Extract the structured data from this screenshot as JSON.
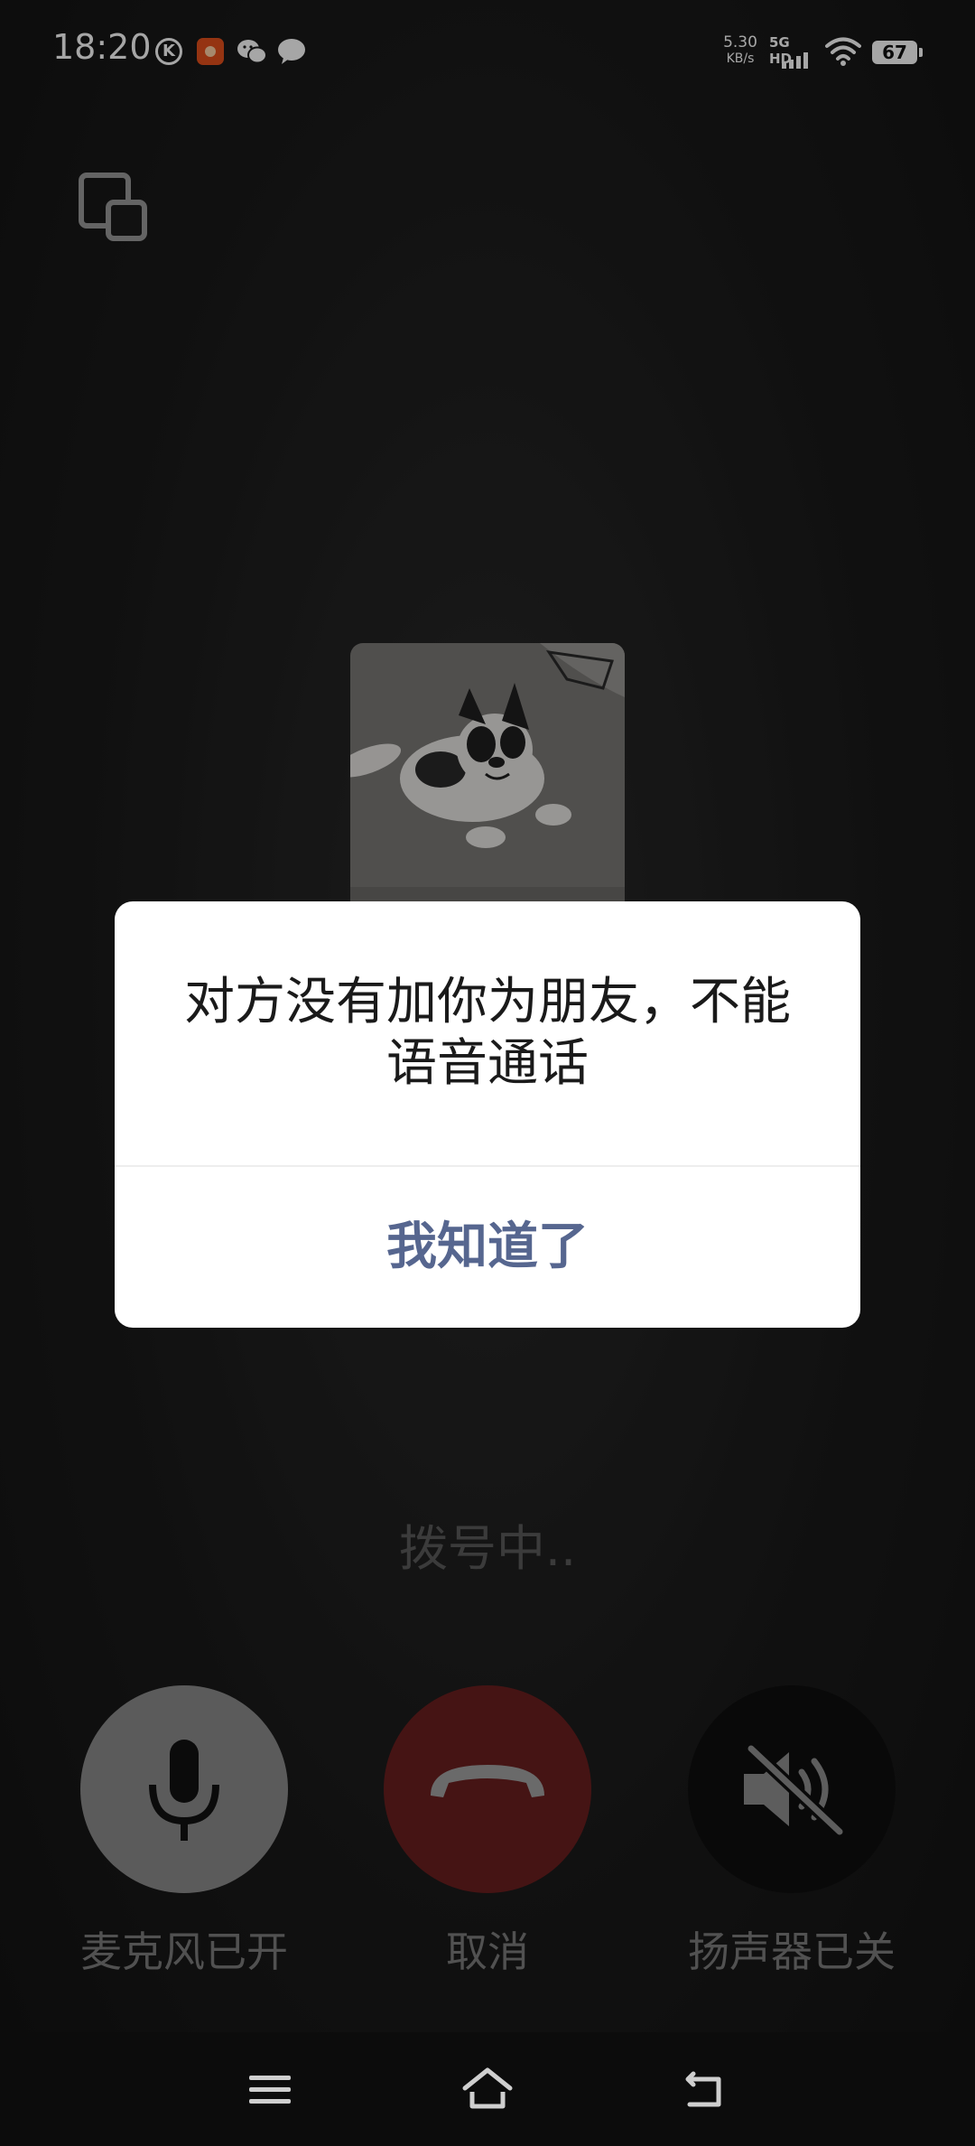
{
  "status_bar": {
    "time": "18:20",
    "net_speed_value": "5.30",
    "net_speed_unit": "KB/s",
    "network_label": "5G HD",
    "battery": "67",
    "notification_icons": [
      "k-app-icon",
      "orange-app-icon",
      "wechat-icon",
      "message-icon"
    ]
  },
  "call": {
    "status_text": "拨号中..",
    "controls": {
      "mic_label": "麦克风已开",
      "cancel_label": "取消",
      "speaker_label": "扬声器已关"
    }
  },
  "dialog": {
    "message": "对方没有加你为朋友，不能语音通话",
    "confirm_label": "我知道了"
  },
  "colors": {
    "background": "#1b1b1b",
    "mic_button": "#8c8c8c",
    "cancel_button": "#6b1f1f",
    "speaker_button": "#0f0f0f",
    "dialog_button_text": "#56668f"
  }
}
